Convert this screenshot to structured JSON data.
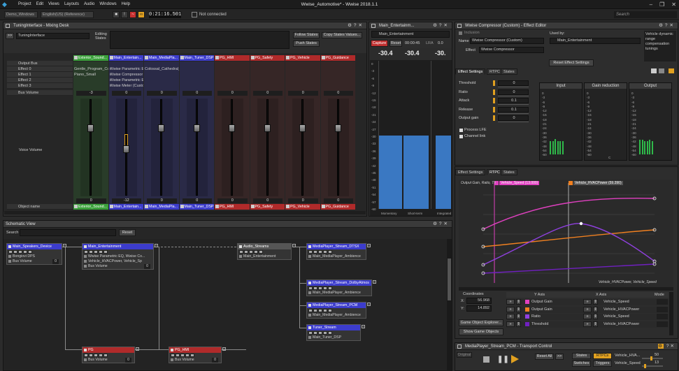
{
  "app": {
    "title": "Wwise_Automotive* - Wwise 2018.1.1",
    "menu": [
      "Project",
      "Edit",
      "Views",
      "Layouts",
      "Audio",
      "Windows",
      "Help"
    ],
    "window_controls": [
      "–",
      "❐",
      "✕"
    ]
  },
  "toolbar": {
    "platform": "Demo_Windows",
    "language": "English(US) (Reference)",
    "timecode": "0:21:16.501",
    "connection": "Not connected",
    "search_placeholder": "Search"
  },
  "mixing_desk": {
    "title": "TuningInterface - Mixing Desk",
    "desk_name": "TuningInterface",
    "editing_states_label": "Editing States",
    "follow_states": "Follow States",
    "copy_states": "Copy States Values...",
    "push_states": "Push States",
    "row_labels": [
      "Output Bus",
      "Effect 0",
      "Effect 1",
      "Effect 2",
      "Effect 3",
      "Bus Volume",
      "Voice Volume",
      "Object name"
    ],
    "channels": [
      {
        "name": "Exterior_Sound...",
        "color": "#3aa03a",
        "effect0": "Gentle_Program_Co...",
        "effect1": "Piano_Small",
        "effect2": "",
        "effect3": "",
        "bus_volume": "-3",
        "voice_volume": "0",
        "knob_frac": 0.26
      },
      {
        "name": "Main_Entertain...",
        "color": "#3c3ccc",
        "effect0": "Wwise Parametric E...",
        "effect1": "Wwise Compressor (...",
        "effect2": "Wwise Parametric E...",
        "effect3": "Wwise Meter (Custom)",
        "bus_volume": "0",
        "voice_volume": "-12",
        "knob_frac": 0.48,
        "selected": true
      },
      {
        "name": "Main_MediaPla...",
        "color": "#3c3ccc",
        "effect0": "Colossal_Cathedral_...",
        "effect1": "",
        "effect2": "",
        "effect3": "",
        "bus_volume": "0",
        "voice_volume": "0",
        "knob_frac": 0.26
      },
      {
        "name": "Main_Tuner_DSP",
        "color": "#3c3ccc",
        "effect0": "",
        "effect1": "",
        "effect2": "",
        "effect3": "",
        "bus_volume": "0",
        "voice_volume": "0",
        "knob_frac": 0.26
      },
      {
        "name": "PG_HMI",
        "color": "#b02a2a",
        "effect0": "",
        "effect1": "",
        "effect2": "",
        "effect3": "",
        "bus_volume": "0",
        "voice_volume": "0",
        "knob_frac": 0.26
      },
      {
        "name": "PG_Safety",
        "color": "#b02a2a",
        "effect0": "",
        "effect1": "",
        "effect2": "",
        "effect3": "",
        "bus_volume": "0",
        "voice_volume": "0",
        "knob_frac": 0.26
      },
      {
        "name": "PG_Vehicle",
        "color": "#b02a2a",
        "effect0": "",
        "effect1": "",
        "effect2": "",
        "effect3": "",
        "bus_volume": "0",
        "voice_volume": "0",
        "knob_frac": 0.26
      },
      {
        "name": "PG_Guidance",
        "color": "#b02a2a",
        "effect0": "",
        "effect1": "",
        "effect2": "",
        "effect3": "",
        "bus_volume": "0",
        "voice_volume": "0",
        "knob_frac": 0.26
      }
    ]
  },
  "meter": {
    "title": "Main_Entertainm...",
    "object": "Main_Entertainment",
    "capture": "Capture",
    "reset": "Reset",
    "time": "00:00:45",
    "lra_label": "LRA",
    "lra_value": "0.0",
    "peak_left": "-30.4",
    "peak_right": "-30.4",
    "peak_third": "-30.",
    "scale": [
      "0",
      "-3",
      "-6",
      "-9",
      "-12",
      "-15",
      "-18",
      "-21",
      "-24",
      "-27",
      "-30",
      "-33",
      "-36",
      "-39",
      "-42",
      "-45",
      "-48",
      "-51",
      "-54",
      "-57",
      "-60"
    ],
    "bar_level_db": -30.4,
    "footer": [
      "Momentary",
      "Short-term",
      "Integrated"
    ]
  },
  "schematic": {
    "title": "Schematic View",
    "search_label": "Search",
    "reset": "Reset",
    "nodes": [
      {
        "id": "speakers",
        "title": "Main_Speakers_Device",
        "color": "#3c3ccc",
        "rows": [
          "Bongiovi DPS"
        ],
        "vol_label": "Bus Volume",
        "vol": "0"
      },
      {
        "id": "entertainment",
        "title": "Main_Entertainment",
        "color": "#3c3ccc",
        "rows": [
          "Wwise Parametric EQ, Wwise Co...",
          "Vehicle_HVACPower, Vehicle_Sp"
        ],
        "vol_label": "Bus Volume",
        "vol": "0"
      },
      {
        "id": "audiostreams",
        "title": "Audio_Streams",
        "color": "#555555",
        "rows": [
          "Main_Entertainment"
        ]
      },
      {
        "id": "dtsx",
        "title": "MediaPlayer_Stream_DTSX",
        "color": "#3c3ccc",
        "rows": [
          "Main_MediaPlayer_Ambience"
        ]
      },
      {
        "id": "dolby",
        "title": "MediaPlayer_Stream_DolbyAtmos",
        "color": "#3c3ccc",
        "rows": [
          "Main_MediaPlayer_Ambience"
        ]
      },
      {
        "id": "pcm",
        "title": "MediaPlayer_Stream_PCM",
        "color": "#3c3ccc",
        "rows": [
          "Main_MediaPlayer_Ambience"
        ]
      },
      {
        "id": "tuner",
        "title": "Tuner_Stream",
        "color": "#3c3ccc",
        "rows": [
          "Main_Tuner_DSP"
        ]
      },
      {
        "id": "pg",
        "title": "PG",
        "color": "#b02a2a",
        "rows": [],
        "vol_label": "Bus Volume",
        "vol": "0"
      },
      {
        "id": "pghmi",
        "title": "PG_HMI",
        "color": "#b02a2a",
        "rows": [],
        "vol_label": "Bus Volume",
        "vol": "0"
      }
    ]
  },
  "effect_editor": {
    "title": "Wwise Compressor (Custom) - Effect Editor",
    "inclusion": "Inclusion",
    "name_label": "Name",
    "name_value": "Wwise Compressor (Custom)",
    "effect_label": "Effect",
    "effect_value": "Wwise Compressor",
    "used_by_label": "Used by:",
    "used_by_value": "Main_Entertainment",
    "notes": "Vehicle dynamic range compensation tunings",
    "reset_button": "Reset Effect Settings",
    "tabs": [
      "Effect Settings",
      "RTPC",
      "States"
    ],
    "params": [
      {
        "label": "Threshold",
        "value": "0"
      },
      {
        "label": "Ratio",
        "value": "0"
      },
      {
        "label": "Attack",
        "value": "0.1"
      },
      {
        "label": "Release",
        "value": "0.1"
      },
      {
        "label": "Output gain",
        "value": "0"
      }
    ],
    "checks": [
      "Process LFE",
      "Channel link"
    ],
    "meter_titles": [
      "Input",
      "Gain reduction",
      "Output"
    ],
    "meter_scale": [
      "0",
      "-3",
      "-6",
      "-9",
      "-12",
      "-15",
      "-18",
      "-21",
      "-24",
      "-30",
      "-36",
      "-42",
      "-48",
      "-54",
      "-60"
    ],
    "gain_reduction_foot": "C",
    "rtpc_tabs": [
      "Effect Settings",
      "RTPC",
      "States"
    ]
  },
  "rtpc_graph": {
    "title": "Output Gain, Ratio, Th",
    "x_axis_label": "Vehicle_HVACPower, Vehicle_Speed",
    "marker1": "Vehicle_Speed (13.000)",
    "marker2": "Vehicle_HVACPower (59.390)",
    "coords_label": "Coordinates",
    "x_label": "X:",
    "x_value": "56.968",
    "y_label": "Y:",
    "y_value": "14.892",
    "game_object_explorer": "Game Object Explorer...",
    "show_game_objects": "Show Game Objects",
    "table_headers": [
      "Y Axis",
      "X Axis",
      "Mode"
    ],
    "rows": [
      {
        "y": "Output Gain",
        "x": "Vehicle_Speed",
        "color": "#e040c0"
      },
      {
        "y": "Output Gain",
        "x": "Vehicle_HVACPower",
        "color": "#f08020"
      },
      {
        "y": "Ratio",
        "x": "Vehicle_Speed",
        "color": "#9040e0"
      },
      {
        "y": "Threshold",
        "x": "Vehicle_HVACPower",
        "color": "#7020c0"
      }
    ],
    "btn_dbl": "»"
  },
  "transport": {
    "title": "MediaPlayer_Stream_PCM - Transport Control",
    "original": "Original",
    "reset_all": "Reset All",
    "states": "States",
    "switches": "Switches",
    "rtpcs": "RTPCs",
    "triggers": "Triggers",
    "rtpc1_name": "Vehicle_HVA...",
    "rtpc1_val": "50",
    "rtpc2_name": "Vehicle_Speed",
    "rtpc2_val": "13"
  }
}
